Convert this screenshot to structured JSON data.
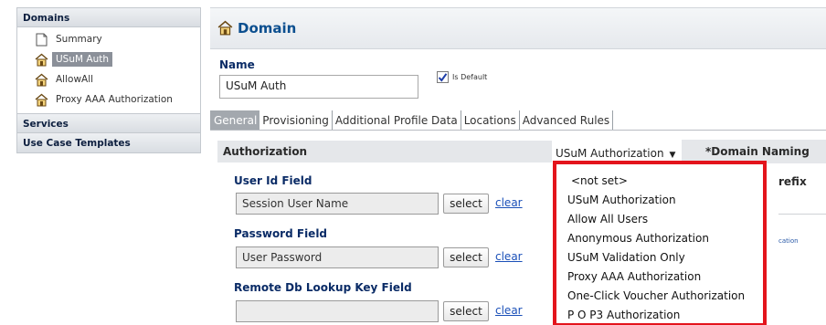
{
  "sidebar": {
    "domains_header": "Domains",
    "items": [
      {
        "label": "Summary",
        "icon": "document-icon",
        "selected": false
      },
      {
        "label": "USuM Auth",
        "icon": "home-icon",
        "selected": true
      },
      {
        "label": "AllowAll",
        "icon": "home-icon",
        "selected": false
      },
      {
        "label": "Proxy AAA Authorization",
        "icon": "home-icon",
        "selected": false
      }
    ],
    "services_header": "Services",
    "templates_header": "Use Case Templates"
  },
  "main": {
    "title": "Domain",
    "name_label": "Name",
    "name_value": "USuM Auth",
    "is_default_label": "Is Default",
    "is_default_checked": true,
    "tabs": [
      {
        "label": "General",
        "active": true
      },
      {
        "label": "Provisioning",
        "active": false
      },
      {
        "label": "Additional Profile Data",
        "active": false
      },
      {
        "label": "Locations",
        "active": false
      },
      {
        "label": "Advanced Rules",
        "active": false
      }
    ],
    "authorization_header": "Authorization",
    "authorization_selected": "USuM Authorization",
    "domain_naming_header": "*Domain Naming",
    "prefix_fragment": "refix",
    "small_fragment": "cation",
    "fields": [
      {
        "label": "User Id Field",
        "value": "Session User Name"
      },
      {
        "label": "Password Field",
        "value": "User Password"
      },
      {
        "label": "Remote Db Lookup Key Field",
        "value": ""
      }
    ],
    "select_label": "select",
    "clear_label": "clear"
  },
  "dropdown": {
    "options": [
      "<not set>",
      "USuM Authorization",
      "Allow All Users",
      "Anonymous Authorization",
      "USuM Validation Only",
      "Proxy AAA Authorization",
      "One-Click Voucher Authorization",
      "P O P3 Authorization"
    ],
    "highlight_color": "#e3141c"
  },
  "colors": {
    "accent_blue": "#0c4f8f",
    "label_navy": "#0a2b66",
    "link_blue": "#1a4fb8",
    "selected_gray": "#8b9099"
  }
}
